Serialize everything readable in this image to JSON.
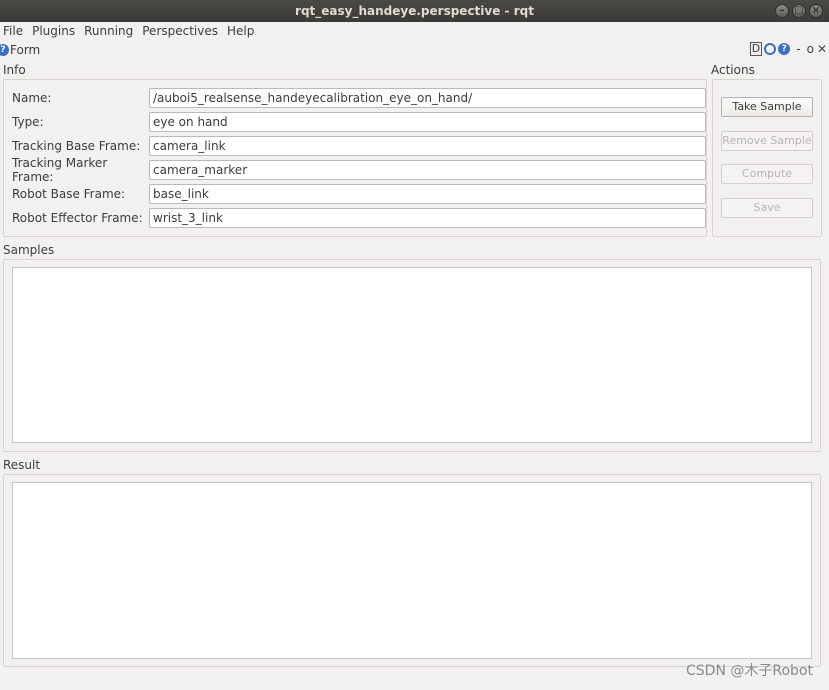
{
  "window": {
    "title": "rqt_easy_handeye.perspective - rqt"
  },
  "menubar": {
    "items": [
      "File",
      "Plugins",
      "Running",
      "Perspectives",
      "Help"
    ]
  },
  "plugin": {
    "title": "Form",
    "controls": [
      "D",
      "-",
      "o",
      "✕"
    ]
  },
  "info": {
    "label": "Info",
    "fields": [
      {
        "label": "Name:",
        "value": "/auboi5_realsense_handeyecalibration_eye_on_hand/"
      },
      {
        "label": "Type:",
        "value": "eye on hand"
      },
      {
        "label": "Tracking Base Frame:",
        "value": "camera_link"
      },
      {
        "label": "Tracking Marker Frame:",
        "value": "camera_marker"
      },
      {
        "label": "Robot Base Frame:",
        "value": "base_link"
      },
      {
        "label": "Robot Effector Frame:",
        "value": "wrist_3_link"
      }
    ]
  },
  "actions": {
    "label": "Actions",
    "buttons": [
      {
        "label": "Take Sample",
        "enabled": true
      },
      {
        "label": "Remove Sample",
        "enabled": false
      },
      {
        "label": "Compute",
        "enabled": false
      },
      {
        "label": "Save",
        "enabled": false
      }
    ]
  },
  "samples": {
    "label": "Samples"
  },
  "result": {
    "label": "Result"
  },
  "watermark": "CSDN @木子Robot"
}
